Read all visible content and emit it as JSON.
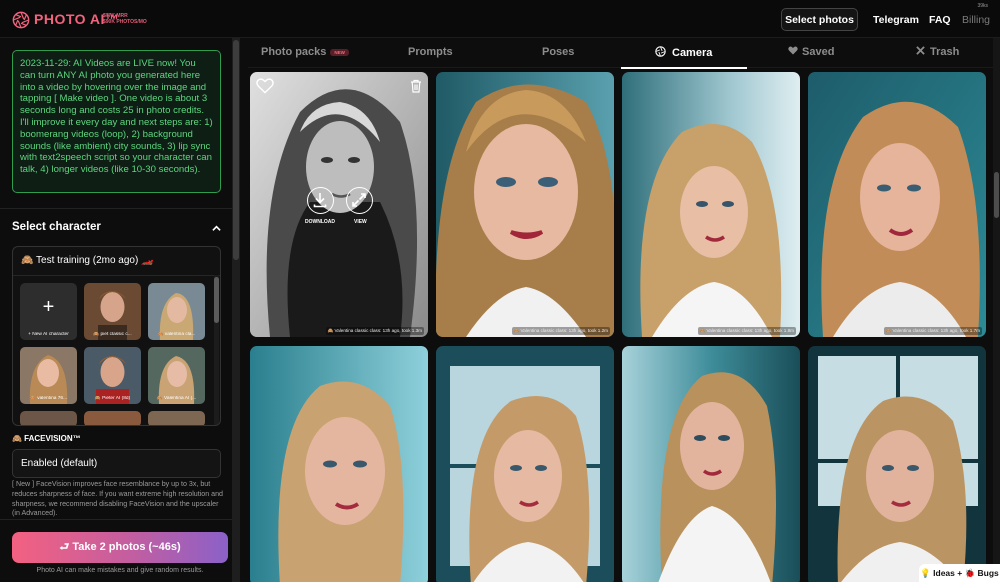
{
  "colors": {
    "brand": "#f2637e",
    "announce_text": "#5cd680",
    "announce_border": "#2e9d4e",
    "cta_start": "#f36181",
    "cta_end": "#8b61c8"
  },
  "header": {
    "logo_icon": "camera-aperture-icon",
    "logo_text": "PHOTO AI™",
    "stats_line1": "$77K MRR",
    "stats_line2": "$90K PHOTOS/MO",
    "corner_text": "39ks",
    "select_photos": "Select photos",
    "nav": [
      "Telegram",
      "FAQ",
      "Billing"
    ]
  },
  "announcement": "2023-11-29: AI Videos are LIVE now! You can turn ANY AI photo you generated here into a video by hovering over the image and tapping [ Make video ]. One video is about 3 seconds long and costs 25 in photo credits. I'll improve it every day and next steps are: 1) boomerang videos (loop), 2) background sounds (like ambient) city sounds, 3) lip sync with text2speech script so your character can talk, 4) longer videos (like 10-30 seconds).",
  "select_character": {
    "title": "Select character",
    "toggle_icon": "chevron-up-icon",
    "current": "🙈 Test training (2mo ago) 🏎️",
    "tiles": [
      {
        "label": "+ New AI character",
        "type": "add"
      },
      {
        "label": "🙈 piet classic c...",
        "type": "man"
      },
      {
        "label": "🙈 valentina cla...",
        "type": "woman"
      },
      {
        "label": "🙈 valentina 76...",
        "type": "woman"
      },
      {
        "label": "🙈 Pieter AI (8d)",
        "type": "man"
      },
      {
        "label": "🙈 Valentina AI (...",
        "type": "woman"
      }
    ]
  },
  "facevision": {
    "title": "🙈 FACEVISION™",
    "value": "Enabled (default)",
    "note": "[ New ] FaceVision improves face resemblance by up to 3x, but reduces sharpness of face. If you want extreme high resolution and sharpness, we recommend disabling FaceVision and the upscaler (in Advanced)."
  },
  "take_button": "⮐ Take 2 photos (~46s)",
  "disclaimer": "Photo AI can make mistakes and give random results.",
  "tabs": [
    {
      "label": "Photo packs",
      "badge": "NEW",
      "icon": ""
    },
    {
      "label": "Prompts",
      "badge": "",
      "icon": ""
    },
    {
      "label": "Poses",
      "badge": "",
      "icon": ""
    },
    {
      "label": "Camera",
      "badge": "",
      "icon": "aperture-icon",
      "active": true
    },
    {
      "label": "Saved",
      "badge": "",
      "icon": "heart-icon"
    },
    {
      "label": "Trash",
      "badge": "",
      "icon": "x-icon"
    }
  ],
  "photo_overlay": {
    "download_label": "DOWNLOAD",
    "view_label": "VIEW",
    "like_icon": "heart-outline-icon",
    "trash_icon": "trash-icon"
  },
  "photos": [
    {
      "caption": "🙈 Valentina classic class: 13h ago, took 1.3m"
    },
    {
      "caption": "🙈 Valentina classic class: 13h ago, took 1.2m"
    },
    {
      "caption": "🙈 Valentina classic class: 13h ago, took 1.8m"
    },
    {
      "caption": "🙈 Valentina classic class: 13h ago, took 1.7m"
    },
    {
      "caption": ""
    },
    {
      "caption": ""
    },
    {
      "caption": ""
    },
    {
      "caption": ""
    }
  ],
  "feedback": "💡 Ideas + 🐞 Bugs"
}
